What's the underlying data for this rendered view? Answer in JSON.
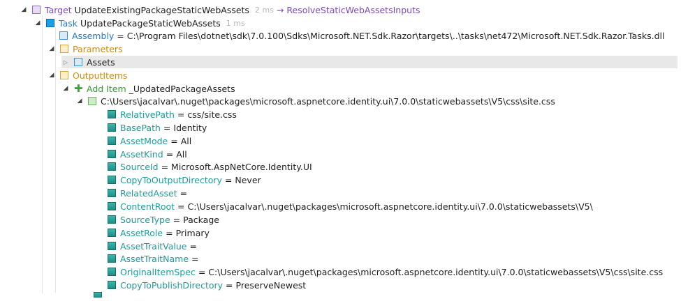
{
  "target": {
    "kind": "Target",
    "name": "UpdateExistingPackageStaticWebAssets",
    "duration": "2 ms",
    "arrow": "→",
    "depends": "ResolveStaticWebAssetsInputs"
  },
  "task": {
    "kind": "Task",
    "name": "UpdatePackageStaticWebAssets",
    "duration": "1 ms"
  },
  "assembly": {
    "label": "Assembly",
    "value": "C:\\Program Files\\dotnet\\sdk\\7.0.100\\Sdks\\Microsoft.NET.Sdk.Razor\\targets\\..\\tasks\\net472\\Microsoft.NET.Sdk.Razor.Tasks.dll"
  },
  "parameters": {
    "label": "Parameters",
    "assets_label": "Assets"
  },
  "output_items": {
    "label": "OutputItems",
    "add_item_label": "Add Item",
    "add_item_name": "_UpdatedPackageAssets",
    "item_path": "C:\\Users\\jacalvar\\.nuget\\packages\\microsoft.aspnetcore.identity.ui\\7.0.0\\staticwebassets\\V5\\css\\site.css"
  },
  "metadata": [
    {
      "key": "RelativePath",
      "value": "css/site.css"
    },
    {
      "key": "BasePath",
      "value": "Identity"
    },
    {
      "key": "AssetMode",
      "value": "All"
    },
    {
      "key": "AssetKind",
      "value": "All"
    },
    {
      "key": "SourceId",
      "value": "Microsoft.AspNetCore.Identity.UI"
    },
    {
      "key": "CopyToOutputDirectory",
      "value": "Never"
    },
    {
      "key": "RelatedAsset",
      "value": ""
    },
    {
      "key": "ContentRoot",
      "value": "C:\\Users\\jacalvar\\.nuget\\packages\\microsoft.aspnetcore.identity.ui\\7.0.0\\staticwebassets\\V5\\"
    },
    {
      "key": "SourceType",
      "value": "Package"
    },
    {
      "key": "AssetRole",
      "value": "Primary"
    },
    {
      "key": "AssetTraitValue",
      "value": ""
    },
    {
      "key": "AssetTraitName",
      "value": ""
    },
    {
      "key": "OriginalItemSpec",
      "value": "C:\\Users\\jacalvar\\.nuget\\packages\\microsoft.aspnetcore.identity.ui\\7.0.0\\staticwebassets\\V5\\css\\site.css"
    },
    {
      "key": "CopyToPublishDirectory",
      "value": "PreserveNewest"
    }
  ],
  "equals": "=",
  "icons": {
    "expanded": "expanded-triangle-icon",
    "collapsed": "collapsed-triangle-icon",
    "add": "add-plus-icon"
  }
}
